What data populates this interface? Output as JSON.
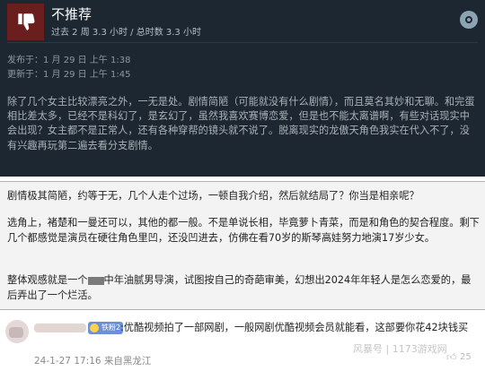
{
  "review": {
    "verdict": "不推荐",
    "hours": "过去 2 周 3.3 小时 / 总时数 3.3 小时",
    "posted": "发布于：1 月 29 日 上午 1:38",
    "updated": "更新于：1 月 29 日 上午 1:45",
    "body": "除了几个女主比较漂亮之外，一无是处。剧情简陋（可能就没有什么剧情），而且莫名其妙和无聊。和完蛋相比差太多，已经不是科幻了，是玄幻了，虽然我喜欢赛博恋爱，但是也不能太离谱啊，有些对话现实中会出现？女主都不是正常人，还有各种穿帮的镜头就不说了。脱离现实的龙傲天角色我实在代入不了，没有兴趣再玩第二遍去看分支剧情。"
  },
  "comment": {
    "p1": "剧情极其简陋，约等于无，几个人走个过场，一顿自我介绍，然后就结局了？你当是相亲呢？",
    "p2": "选角上，褚楚和一曼还可以，其他的都一般。不是单说长相，毕竟萝卜青菜，而是和角色的契合程度。剩下几个都感觉是演员在硬往角色里凹，还没凹进去，仿佛在看70岁的斯琴高娃努力地演17岁少女。",
    "p3_before": "整体观感就是一个",
    "p3_after": "中年油腻男导演，试图按自己的奇葩审美，幻想出2024年年轻人是怎么恋爱的，最后弄出了一个烂活。"
  },
  "reply": {
    "badge": "铁粉2",
    "text": ":优酷视频拍了一部网剧，一般网剧优酷视频会员就能看，这部要你花42块钱买",
    "meta": "24-1-27 17:16 来自黑龙江",
    "like_count": "25"
  },
  "watermark": "风暴号 | 1173游戏网",
  "colors": {
    "steam_bg": "#1c2732",
    "thumb_red": "#6b1e1e",
    "comment_bg": "#f3f3f3"
  },
  "icons": [
    "thumbs-down-icon",
    "steam-logo-icon",
    "like-icon"
  ]
}
